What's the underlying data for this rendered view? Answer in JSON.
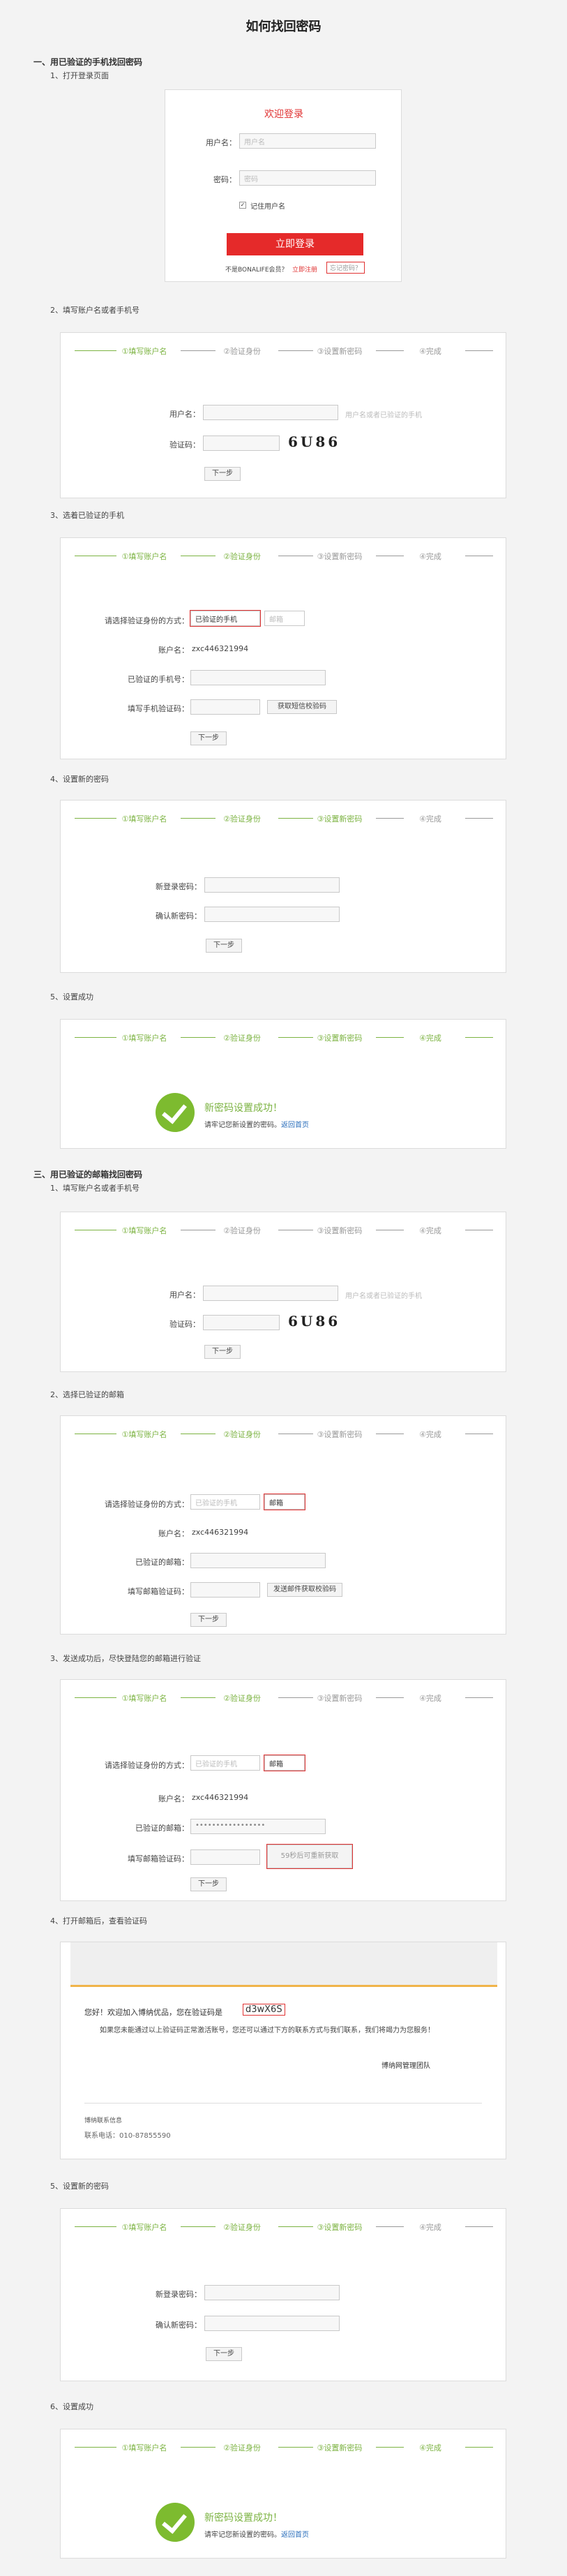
{
  "page": {
    "title": "如何找回密码"
  },
  "section1": {
    "title": "一、用已验证的手机找回密码"
  },
  "section2": {
    "title": "三、用已验证的邮箱找回密码"
  },
  "login": {
    "heading": "欢迎登录",
    "username_label": "用户名：",
    "username_ph": "用户名",
    "password_label": "密码：",
    "password_ph": "密码",
    "remember": "记住用户名",
    "submit": "立即登录",
    "register_prefix": "不是BONALIFE会员？",
    "register_link": "立即注册",
    "forgot_link": "忘记密码？"
  },
  "progress": [
    "①填写账户名",
    "②验证身份",
    "③设置新密码",
    "④完成"
  ],
  "fields": {
    "username": "用户名：",
    "username_hint": "用户名或者已验证的手机",
    "captcha": "验证码：",
    "captcha_code": "6U86",
    "next": "下一步",
    "method": "请选择验证身份的方式：",
    "phone_opt": "已验证的手机",
    "email_opt": "邮箱",
    "account": "账户名：",
    "account_val": "zxc446321994",
    "verified_phone": "已验证的手机号：",
    "phone_code": "填写手机验证码：",
    "get_sms": "获取短信校验码",
    "new_pw": "新登录密码：",
    "confirm_pw": "确认新密码：",
    "verified_email": "已验证的邮箱：",
    "email_code": "填写邮箱验证码：",
    "send_email": "发送邮件获取校验码",
    "email_masked": "•••••••••••••••••",
    "resend": "59秒后可重新获取"
  },
  "success": {
    "msg": "新密码设置成功！",
    "sub": "请牢记您新设置的密码。",
    "home": "返回首页"
  },
  "steps": {
    "m1": "1、打开登录页面",
    "m2": "2、填写账户名或者手机号",
    "m3": "3、选着已验证的手机",
    "m4": "4、设置新的密码",
    "m5": "5、设置成功",
    "e1": "1、填写账户名或者手机号",
    "e2": "2、选择已验证的邮箱",
    "e3": "3、发送成功后，尽快登陆您的邮箱进行验证",
    "e4": "4、打开邮箱后，查看验证码",
    "e5": "5、设置新的密码",
    "e6": "6、设置成功"
  },
  "email": {
    "greeting_prefix": "您好！欢迎加入博纳优品，您在验证码是",
    "code": "d3wX6S",
    "body": "如果您未能通过以上验证码正常激活账号，您还可以通过下方的联系方式与我们联系，我们将竭力为您服务！",
    "sign": "博纳网管理团队",
    "company": "博纳联系信息",
    "phone": "联系电话：010-87855590"
  }
}
